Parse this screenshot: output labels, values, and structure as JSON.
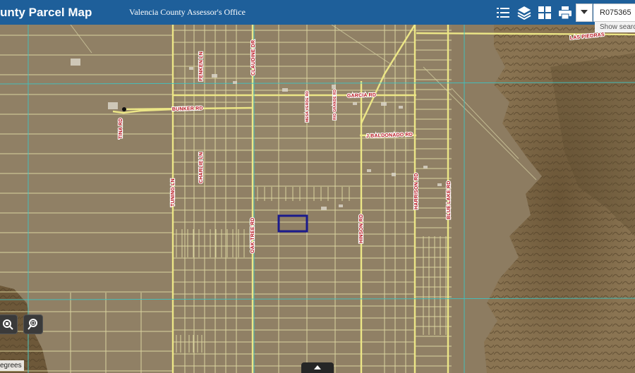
{
  "header": {
    "title": "unty Parcel Map",
    "subtitle": "Valencia County Assessor's Office",
    "search_value": "R075365",
    "show_search": "Show search",
    "icons": [
      "legend-list-icon",
      "layers-icon",
      "basemap-grid-icon",
      "print-icon",
      "chevron-down-icon"
    ]
  },
  "map": {
    "scale_label": "egrees",
    "road_labels": {
      "las_piedras": "LAS PIEDRAS",
      "fenken_ln": "FENKEN LN",
      "claudine_dr": "CLAUDINE DR",
      "garcia_rd": "GARCIA RD",
      "bunker_rd": "BUNKER RD",
      "tina_rd": "TINA RD",
      "j_baldonado_rd": "J BALDONADO RD",
      "charlie_ln": "CHARLIE LN",
      "tuning_ln": "TUNING LN",
      "oak_tree_rd": "OAK TREE RD",
      "hinson_rd": "HINSON RD",
      "harrison_rd": "HARRISON RD",
      "blue_lake_rd": "BLUE LAKE RD",
      "small_rd_1": "MESA VERDE RD",
      "small_rd_2": "RIO GRANDE RD"
    },
    "selected_parcel_color": "#1a1a8c",
    "parcel_line_color": "#e8e3a8",
    "grid_line_color": "#3ec3c3",
    "tools": [
      "identify-tool-icon",
      "search-zoom-icon"
    ]
  }
}
